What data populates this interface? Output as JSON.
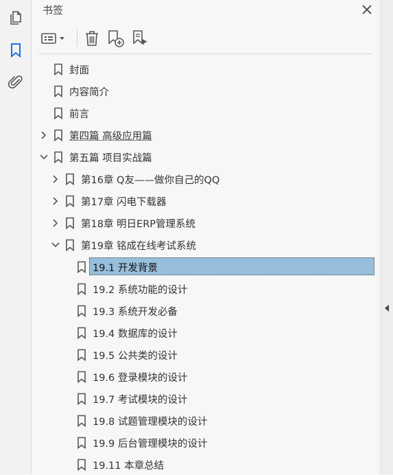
{
  "panel": {
    "title": "书签"
  },
  "left_sidebar": {
    "icons": [
      "pages-icon",
      "bookmark-icon",
      "attachment-icon"
    ]
  },
  "toolbar": {
    "buttons": [
      "options-dropdown",
      "delete-bookmark",
      "new-bookmark",
      "new-bookmark-from-structure"
    ]
  },
  "bookmarks": [
    {
      "label": "封面",
      "level": 0,
      "expander": "none"
    },
    {
      "label": "内容简介",
      "level": 0,
      "expander": "none"
    },
    {
      "label": "前言",
      "level": 0,
      "expander": "none"
    },
    {
      "label": "第四篇 高级应用篇",
      "level": 0,
      "expander": "collapsed",
      "underline": true
    },
    {
      "label": "第五篇 项目实战篇",
      "level": 0,
      "expander": "expanded"
    },
    {
      "label": "第16章 Q友——做你自己的QQ",
      "level": 1,
      "expander": "collapsed"
    },
    {
      "label": "第17章 闪电下载器",
      "level": 1,
      "expander": "collapsed"
    },
    {
      "label": "第18章 明日ERP管理系统",
      "level": 1,
      "expander": "collapsed"
    },
    {
      "label": "第19章 铭成在线考试系统",
      "level": 1,
      "expander": "expanded"
    },
    {
      "label": "19.1 开发背景",
      "level": 2,
      "expander": "none",
      "selected": true
    },
    {
      "label": "19.2 系统功能的设计",
      "level": 2,
      "expander": "none"
    },
    {
      "label": "19.3 系统开发必备",
      "level": 2,
      "expander": "none"
    },
    {
      "label": "19.4 数据库的设计",
      "level": 2,
      "expander": "none"
    },
    {
      "label": "19.5 公共类的设计",
      "level": 2,
      "expander": "none"
    },
    {
      "label": "19.6 登录模块的设计",
      "level": 2,
      "expander": "none"
    },
    {
      "label": "19.7 考试模块的设计",
      "level": 2,
      "expander": "none"
    },
    {
      "label": "19.8 试题管理模块的设计",
      "level": 2,
      "expander": "none"
    },
    {
      "label": "19.9 后台管理模块的设计",
      "level": 2,
      "expander": "none"
    },
    {
      "label": "19.11 本章总结",
      "level": 2,
      "expander": "none"
    }
  ],
  "colors": {
    "selection": "#97bfdb",
    "accent": "#1473e6",
    "panel_bg": "#f7f7f7"
  }
}
